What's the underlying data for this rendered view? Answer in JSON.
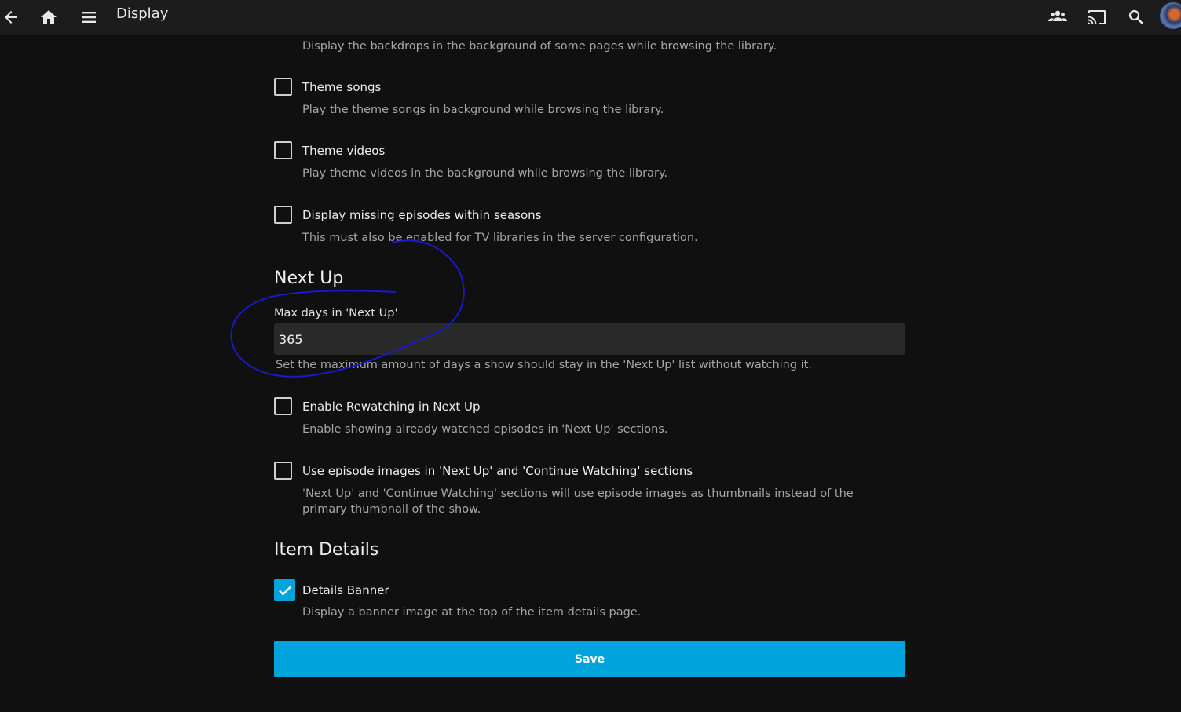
{
  "header": {
    "title": "Display",
    "icons": [
      "back-arrow-icon",
      "home-icon",
      "menu-icon",
      "users-icon",
      "cast-icon",
      "search-icon",
      "avatar"
    ]
  },
  "top_description": "Display the backdrops in the background of some pages while browsing the library.",
  "options": [
    {
      "label": "Theme songs",
      "description": "Play the theme songs in background while browsing the library.",
      "checked": false
    },
    {
      "label": "Theme videos",
      "description": "Play theme videos in the background while browsing the library.",
      "checked": false
    },
    {
      "label": "Display missing episodes within seasons",
      "description": "This must also be enabled for TV libraries in the server configuration.",
      "checked": false
    }
  ],
  "next_up": {
    "title": "Next Up",
    "max_days_label": "Max days in 'Next Up'",
    "max_days_value": "365",
    "max_days_description": "Set the maximum amount of days a show should stay in the 'Next Up' list without watching it.",
    "options": [
      {
        "label": "Enable Rewatching in Next Up",
        "description": "Enable showing already watched episodes in 'Next Up' sections.",
        "checked": false
      },
      {
        "label": "Use episode images in 'Next Up' and 'Continue Watching' sections",
        "description": "'Next Up' and 'Continue Watching' sections will use episode images as thumbnails instead of the primary thumbnail of the show.",
        "checked": false
      }
    ]
  },
  "item_details": {
    "title": "Item Details",
    "options": [
      {
        "label": "Details Banner",
        "description": "Display a banner image at the top of the item details page.",
        "checked": true
      }
    ]
  },
  "save_label": "Save",
  "colors": {
    "accent": "#00a4dc",
    "background": "#101010",
    "header": "#1c1c1c",
    "annotation_ink": "#1a1acc"
  }
}
